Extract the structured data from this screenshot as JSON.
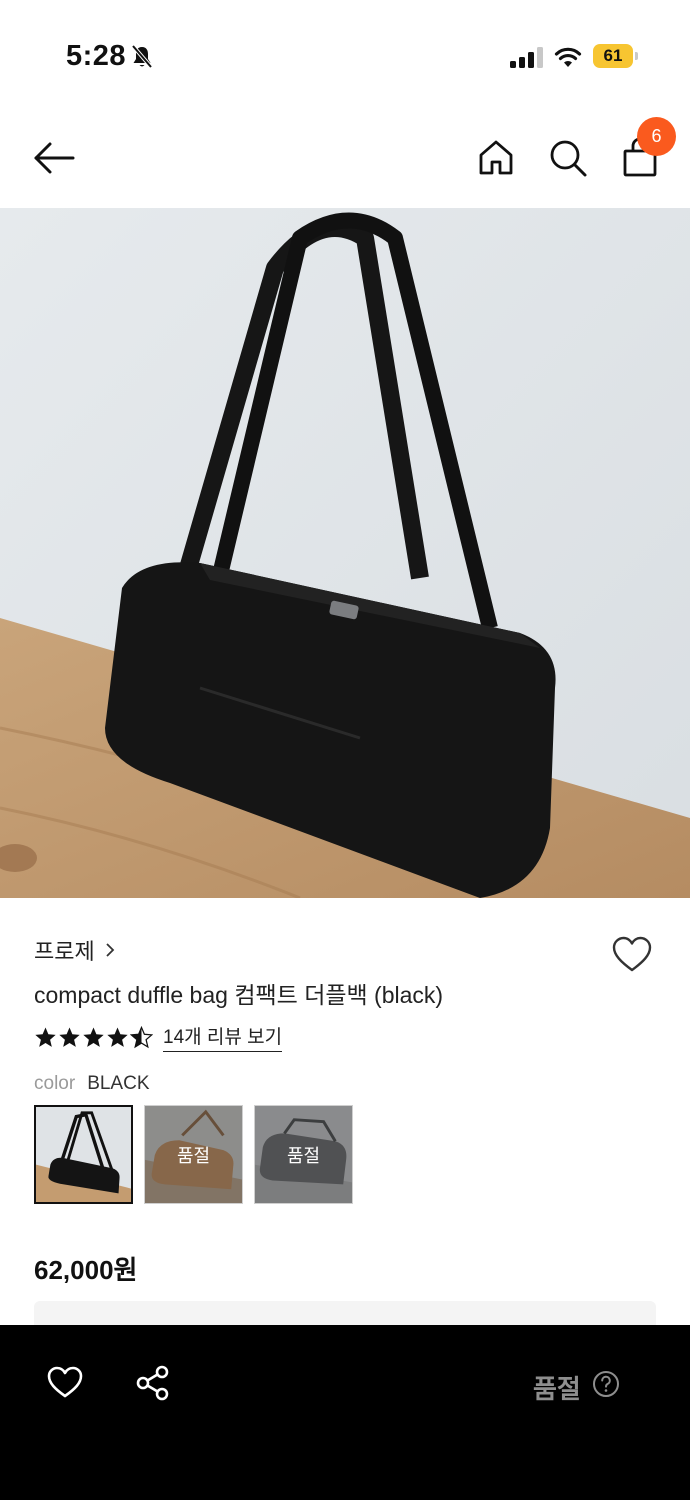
{
  "status_bar": {
    "time": "5:28",
    "battery": "61",
    "icons": [
      "bell-slash-icon",
      "signal-icon",
      "wifi-icon",
      "battery-icon"
    ]
  },
  "header": {
    "icons": [
      "back-arrow-icon",
      "home-icon",
      "search-icon",
      "shopping-bag-icon"
    ],
    "cart_count": "6"
  },
  "product": {
    "image": "black-duffle-bag-photo",
    "brand": "프로제",
    "title": "compact duffle bag 컴팩트 더플백 (black)",
    "rating": 4.5,
    "review_link": "14개 리뷰 보기",
    "color_label": "color",
    "color_value": "BLACK",
    "swatches": [
      {
        "color": "black",
        "soldout": ""
      },
      {
        "color": "brown",
        "soldout": "품절"
      },
      {
        "color": "gray",
        "soldout": "품절"
      }
    ],
    "price": "62,000원"
  },
  "bottom_bar": {
    "soldout": "품절",
    "icons": [
      "heart-icon",
      "share-icon",
      "help-circle-icon"
    ]
  },
  "colors": {
    "badge": "#fa5a1e",
    "battery": "#f7c531",
    "bottom_bar": "#000000",
    "soldout_text": "#8e8e8e"
  }
}
